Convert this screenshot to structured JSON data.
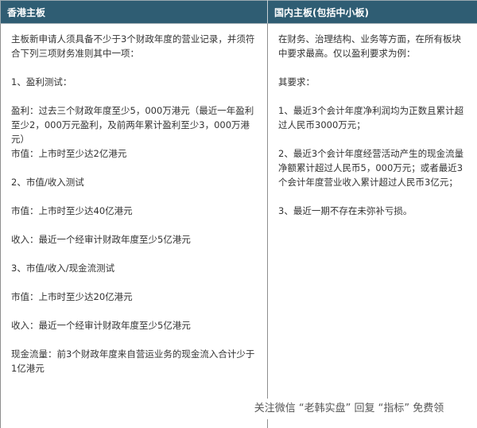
{
  "headers": {
    "left": "香港主板",
    "right": "国内主板(包括中小板)"
  },
  "left_column": [
    "主板新申请人须具备不少于3个财政年度的营业记录，并须符合下列三项财务准则其中一项：",
    "1、盈利测试：",
    "盈利：过去三个财政年度至少5，000万港元（最近一年盈利至少2，000万元盈利，及前两年累计盈利至少3，000万港元）",
    "市值：上市时至少达2亿港元",
    "2、市值/收入测试",
    "市值：上市时至少达40亿港元",
    "收入：最近一个经审计财政年度至少5亿港元",
    "3、市值/收入/现金流测试",
    "市值：上市时至少达20亿港元",
    "收入：最近一个经审计财政年度至少5亿港元",
    "现金流量：前3个财政年度来自营运业务的现金流入合计少于1亿港元"
  ],
  "right_column": [
    "在财务、治理结构、业务等方面，在所有板块中要求最高。仅以盈利要求为例：",
    "其要求：",
    "1、最近3个会计年度净利润均为正数且累计超过人民币3000万元；",
    "2、最近3个会计年度经营活动产生的现金流量净额累计超过人民币5，000万元；或者最近3个会计年度营业收入累计超过人民币3亿元；",
    "3、最近一期不存在未弥补亏损。"
  ],
  "watermark": "关注微信 “老韩实盘” 回复 “指标” 免费领"
}
